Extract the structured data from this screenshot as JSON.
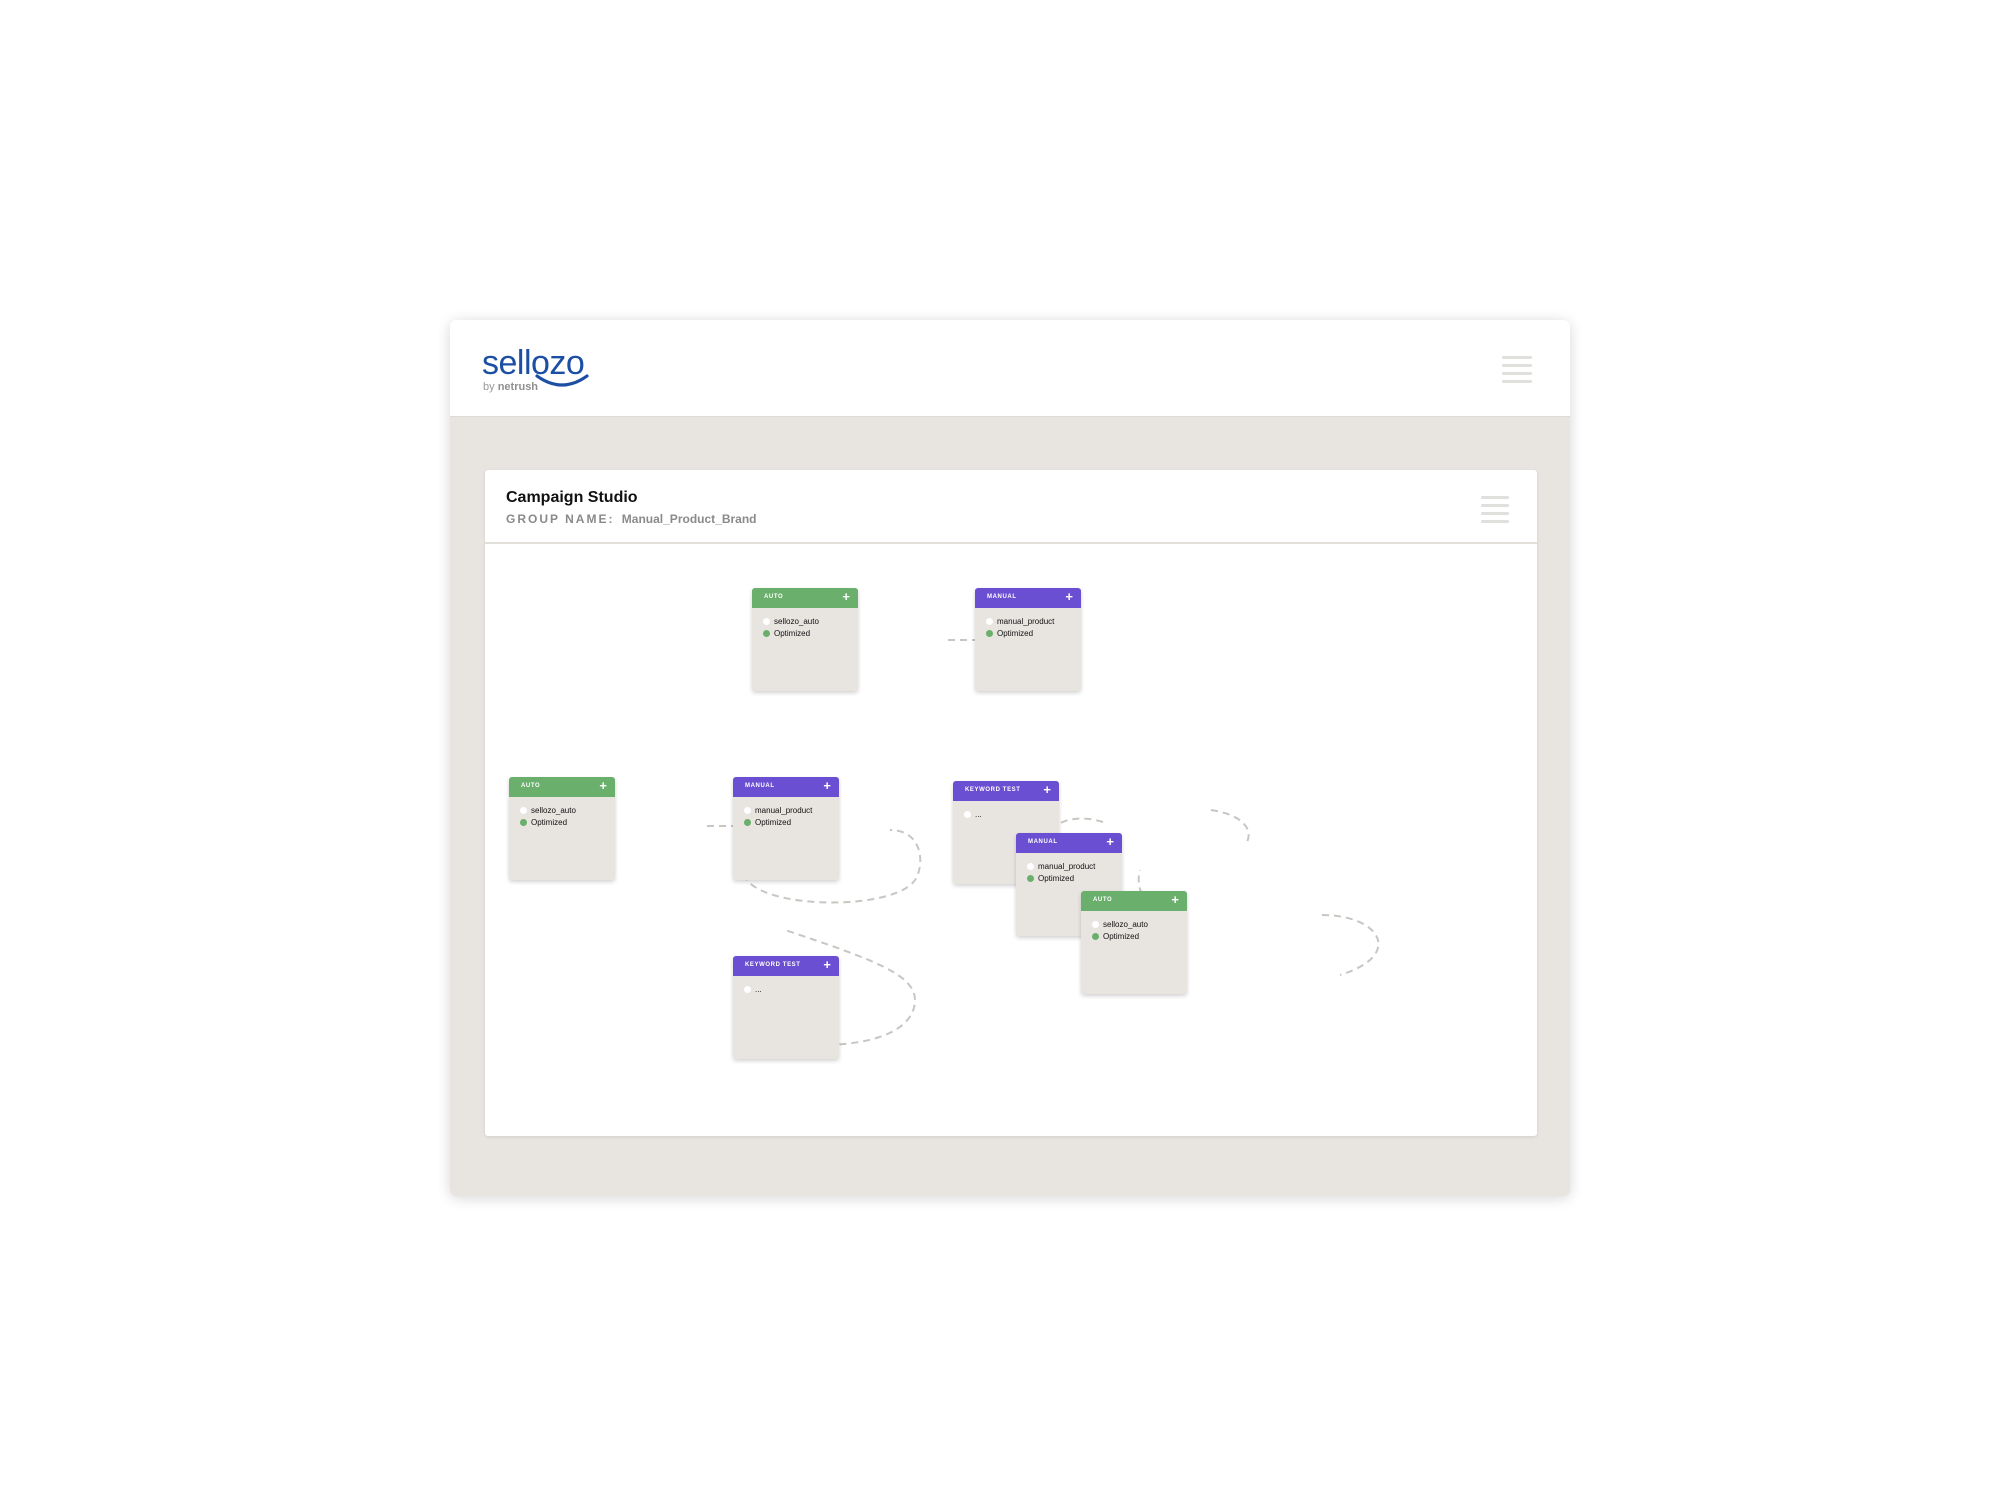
{
  "brand": {
    "name": "sellozo",
    "byline_prefix": "by",
    "byline_brand": "netrush",
    "color": "#1c4fa3"
  },
  "header": {
    "menu_icon": "hamburger-menu-icon"
  },
  "studio": {
    "title": "Campaign Studio",
    "group_label": "GROUP NAME:",
    "group_value": "Manual_Product_Brand",
    "menu_icon": "hamburger-menu-icon"
  },
  "colors": {
    "auto": "#6aaf6c",
    "manual": "#6a4fd2",
    "keyword_test": "#6a4fd2",
    "status_optimized": "#6aaf6c"
  },
  "nodes": [
    {
      "id": "n1",
      "type_label": "AUTO",
      "kind": "auto",
      "add_label": "+",
      "name": "sellozo_auto",
      "status": "Optimized"
    },
    {
      "id": "n2",
      "type_label": "MANUAL",
      "kind": "manual",
      "add_label": "+",
      "name": "manual_product",
      "status": "Optimized"
    },
    {
      "id": "n3",
      "type_label": "AUTO",
      "kind": "auto",
      "add_label": "+",
      "name": "sellozo_auto",
      "status": "Optimized"
    },
    {
      "id": "n4",
      "type_label": "MANUAL",
      "kind": "manual",
      "add_label": "+",
      "name": "manual_product",
      "status": "Optimized"
    },
    {
      "id": "n5",
      "type_label": "KEYWORD TEST",
      "kind": "keyword",
      "add_label": "+",
      "name": "...",
      "status": ""
    },
    {
      "id": "n6",
      "type_label": "KEYWORD TEST",
      "kind": "keyword",
      "add_label": "+",
      "name": "...",
      "status": ""
    },
    {
      "id": "n7",
      "type_label": "MANUAL",
      "kind": "manual",
      "add_label": "+",
      "name": "manual_product",
      "status": "Optimized"
    },
    {
      "id": "n8",
      "type_label": "AUTO",
      "kind": "auto",
      "add_label": "+",
      "name": "sellozo_auto",
      "status": "Optimized"
    }
  ]
}
